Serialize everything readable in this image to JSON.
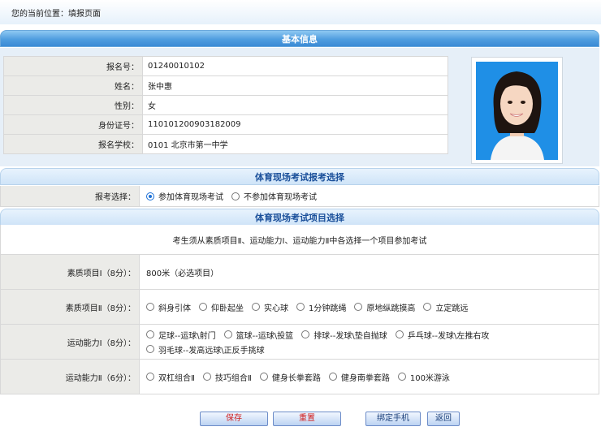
{
  "breadcrumb": "您的当前位置：填报页面",
  "sections": {
    "basic": "基本信息",
    "exam_choice": "体育现场考试报考选择",
    "exam_items": "体育现场考试项目选择"
  },
  "basic_info": [
    {
      "label": "报名号：",
      "value": "01240010102"
    },
    {
      "label": "姓名：",
      "value": "张中惠"
    },
    {
      "label": "性别：",
      "value": "女"
    },
    {
      "label": "身份证号：",
      "value": "110101200903182009"
    },
    {
      "label": "报名学校：",
      "value": "0101 北京市第一中学"
    }
  ],
  "exam_choice": {
    "label": "报考选择：",
    "options": [
      {
        "text": "参加体育现场考试",
        "selected": true
      },
      {
        "text": "不参加体育现场考试",
        "selected": false
      }
    ]
  },
  "notice": "考生须从素质项目Ⅱ、运动能力Ⅰ、运动能力Ⅱ中各选择一个项目参加考试",
  "items": {
    "quality1": {
      "label": "素质项目Ⅰ（8分）：",
      "text": "800米（必选项目）"
    },
    "quality2": {
      "label": "素质项目Ⅱ（8分）：",
      "options": [
        "斜身引体",
        "仰卧起坐",
        "实心球",
        "1分钟跳绳",
        "原地纵跳摸高",
        "立定跳远"
      ]
    },
    "ability1": {
      "label": "运动能力Ⅰ（8分）：",
      "options": [
        "足球--运球\\射门",
        "篮球--运球\\投篮",
        "排球--发球\\垫自抛球",
        "乒乓球--发球\\左推右攻",
        "羽毛球--发高远球\\正反手挑球"
      ]
    },
    "ability2": {
      "label": "运动能力Ⅱ（6分）：",
      "options": [
        "双杠组合Ⅱ",
        "技巧组合Ⅱ",
        "健身长拳套路",
        "健身南拳套路",
        "100米游泳"
      ]
    }
  },
  "buttons": {
    "save": "保存",
    "reset": "重置",
    "bind_phone": "绑定手机",
    "back": "返回"
  },
  "colors": {
    "header_blue": "#3a8ad5",
    "label_bg": "#ebebe8",
    "radio_selected": "#1a6fd6",
    "button_red_text": "#d02020"
  }
}
